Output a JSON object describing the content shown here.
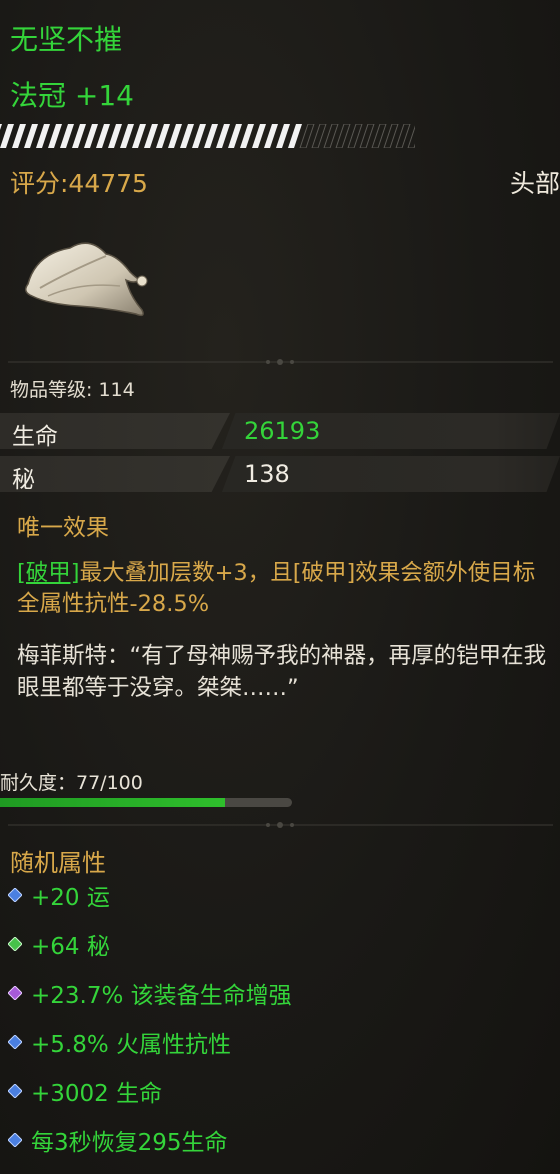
{
  "item": {
    "name": "无坚不摧",
    "subtitle": "法冠 +14",
    "score_text": "评分:44775",
    "slot": "头部",
    "icon": "wizard-hat-icon",
    "item_level_text": "物品等级: 114"
  },
  "stats": [
    {
      "label": "生命",
      "value": "26193",
      "color": "#34d43a"
    },
    {
      "label": "秘",
      "value": "138",
      "color": "#f0ece2"
    }
  ],
  "unique_effect": {
    "title": "唯一效果",
    "keyword": "[破甲]",
    "text": "最大叠加层数+3，且[破甲]效果会额外使目标全属性抗性-28.5%",
    "lore": "梅菲斯特：“有了母神赐予我的神器，再厚的铠甲在我眼里都等于没穿。桀桀……”"
  },
  "durability": {
    "label": "耐久度：77/100",
    "current": 77,
    "max": 100
  },
  "random_attributes": {
    "title": "随机属性",
    "affixes": [
      {
        "text": "+20 运",
        "gem": "blue-gem-icon",
        "gem_color": "#4a7fe0"
      },
      {
        "text": "+64 秘",
        "gem": "green-gem-icon",
        "gem_color": "#46c24a"
      },
      {
        "text": "+23.7% 该装备生命增强",
        "gem": "purple-gem-icon",
        "gem_color": "#a65ad8"
      },
      {
        "text": "+5.8% 火属性抗性",
        "gem": "blue-gem-icon",
        "gem_color": "#4a7fe0"
      },
      {
        "text": "+3002 生命",
        "gem": "blue-gem-icon",
        "gem_color": "#4a7fe0"
      },
      {
        "text": "每3秒恢复295生命",
        "gem": "blue-gem-icon",
        "gem_color": "#4a7fe0"
      }
    ]
  }
}
